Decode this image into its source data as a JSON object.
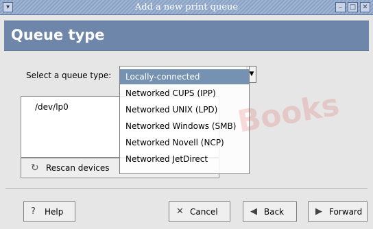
{
  "window": {
    "title": "Add a new print queue"
  },
  "header": {
    "title": "Queue type"
  },
  "queue_type": {
    "label": "Select a queue type:",
    "selected": "Locally-connected",
    "options": [
      "Locally-connected",
      "Networked CUPS (IPP)",
      "Networked UNIX (LPD)",
      "Networked Windows (SMB)",
      "Networked Novell (NCP)",
      "Networked JetDirect"
    ]
  },
  "devices": {
    "items": [
      "/dev/lp0"
    ],
    "rescan_label": "Rescan devices"
  },
  "buttons": {
    "help": "Help",
    "cancel": "Cancel",
    "back": "Back",
    "forward": "Forward"
  },
  "watermark": {
    "text": "Books"
  },
  "colors": {
    "title_bar": "#8aa2c4",
    "header_band": "#6e86a9",
    "selection": "#7692b3"
  }
}
